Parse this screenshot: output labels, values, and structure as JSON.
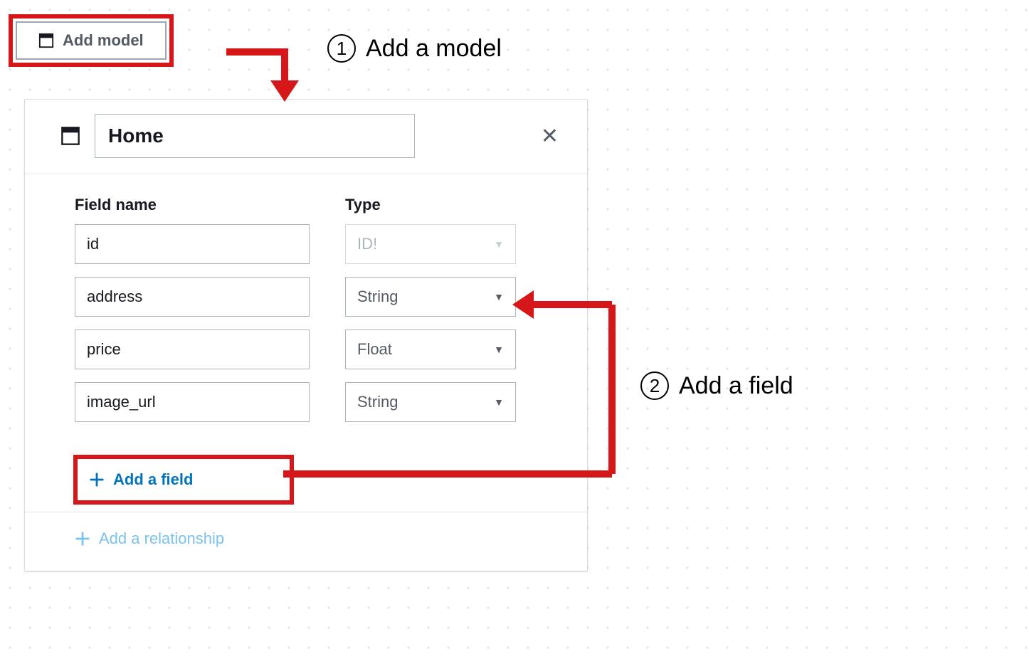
{
  "toolbar": {
    "add_model_label": "Add model"
  },
  "model": {
    "name": "Home",
    "column_field": "Field name",
    "column_type": "Type",
    "fields": [
      {
        "name": "id",
        "type": "ID!",
        "locked": true
      },
      {
        "name": "address",
        "type": "String",
        "locked": false
      },
      {
        "name": "price",
        "type": "Float",
        "locked": false
      },
      {
        "name": "image_url",
        "type": "String",
        "locked": false
      }
    ],
    "add_field_label": "Add a field",
    "add_relationship_label": "Add a relationship"
  },
  "annotations": {
    "step1_num": "1",
    "step1_text": "Add a model",
    "step2_num": "2",
    "step2_text": "Add a field"
  }
}
